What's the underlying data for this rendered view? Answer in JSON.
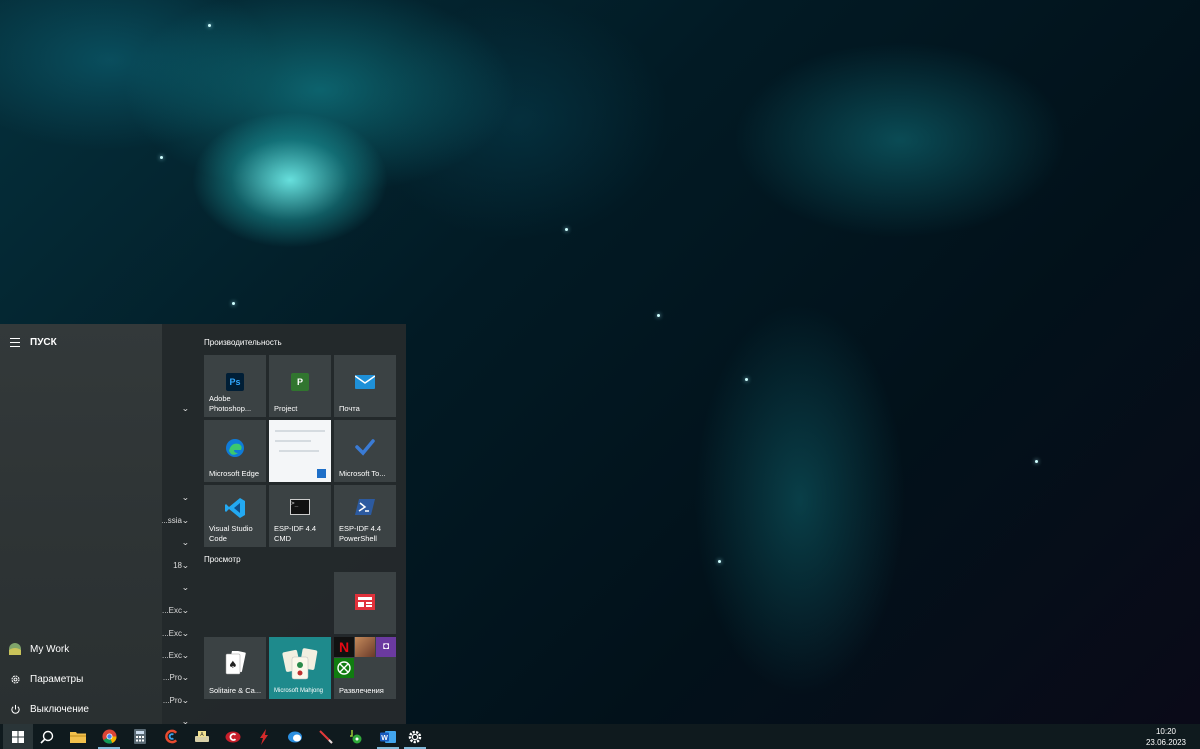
{
  "start_menu": {
    "title": "ПУСК",
    "rail": {
      "user_label": "My Work",
      "settings_label": "Параметры",
      "power_label": "Выключение"
    },
    "app_list_fragments": [
      {
        "text": "",
        "chevron": "⌄"
      },
      {
        "text": "",
        "chevron": "⌄"
      },
      {
        "text": "ssia...",
        "chevron": "⌄"
      },
      {
        "text": "",
        "chevron": "⌄"
      },
      {
        "text": "18",
        "chevron": "⌄"
      },
      {
        "text": "",
        "chevron": "⌄"
      },
      {
        "text": "Exc...",
        "chevron": "⌄"
      },
      {
        "text": "Exc...",
        "chevron": "⌄"
      },
      {
        "text": "Exc...",
        "chevron": "⌄"
      },
      {
        "text": "Pro...",
        "chevron": "⌄"
      },
      {
        "text": "Pro...",
        "chevron": "⌄"
      },
      {
        "text": "",
        "chevron": "⌄"
      }
    ],
    "groups": [
      {
        "label": "Производительность"
      },
      {
        "label": "Просмотр"
      }
    ],
    "tiles": {
      "photoshop": {
        "label": "Adobe Photoshop...",
        "icon": "Ps"
      },
      "project": {
        "label": "Project",
        "icon": "P"
      },
      "mail": {
        "label": "Почта"
      },
      "edge": {
        "label": "Microsoft Edge"
      },
      "todo": {
        "label": "Microsoft To..."
      },
      "vscode": {
        "label": "Visual Studio Code"
      },
      "espidf_cmd": {
        "label": "ESP-IDF 4.4 CMD"
      },
      "espidf_ps": {
        "label": "ESP-IDF 4.4 PowerShell"
      },
      "solitaire": {
        "label": "Solitaire & Ca..."
      },
      "mahjong": {
        "label": "Microsoft Mahjong"
      },
      "entertainment": {
        "label": "Развлечения"
      }
    }
  },
  "taskbar": {
    "time": "10:20",
    "date": "23.06.2023"
  },
  "colors": {
    "accent": "#1e90d8",
    "photoshop": "#31a8ff",
    "project": "#31752f",
    "netflix": "#e50914",
    "xbox": "#107c10"
  }
}
